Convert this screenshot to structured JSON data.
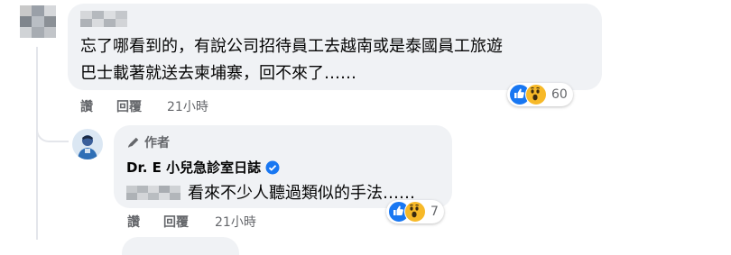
{
  "comment1": {
    "text_line1": "忘了哪看到的，有說公司招待員工去越南或是泰國員工旅遊",
    "text_line2": "巴士載著就送去柬埔寨，回不來了……",
    "like_label": "讚",
    "reply_label": "回覆",
    "time": "21小時",
    "reaction_count": "60"
  },
  "reply": {
    "badge_label": "作者",
    "author_name": "Dr. E 小兒急診室日誌",
    "text": "看來不少人聽過類似的手法……",
    "like_label": "讚",
    "reply_label": "回覆",
    "time": "21小時",
    "reaction_count": "7"
  },
  "icons": [
    "like-reaction-icon",
    "wow-reaction-icon",
    "pen-icon",
    "verified-badge-icon"
  ],
  "colors": {
    "bubble": "#f0f2f5",
    "like": "#1877f2",
    "wow": "#f7b928",
    "meta": "#65676b"
  }
}
